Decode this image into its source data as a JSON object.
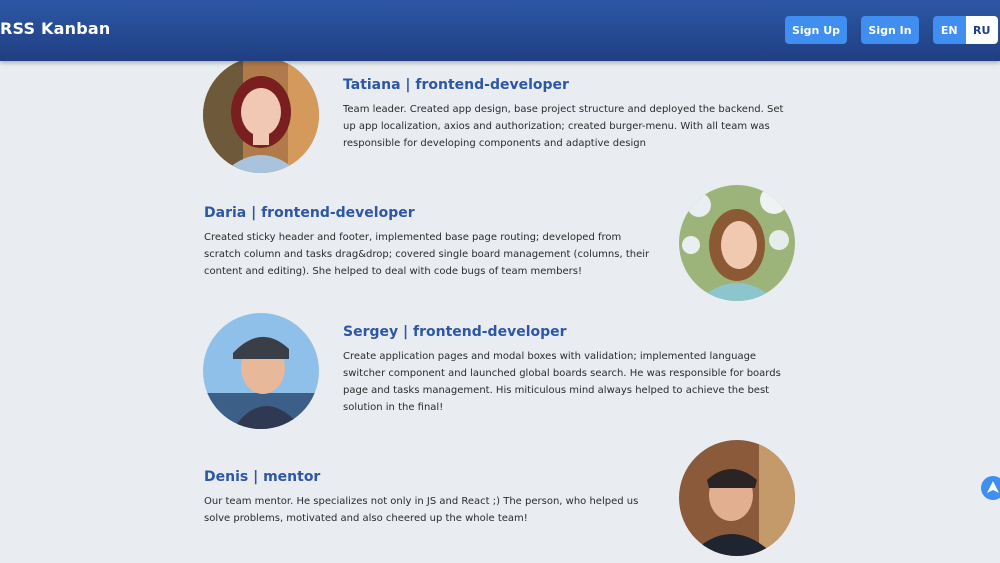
{
  "header": {
    "logo": "RSS Kanban",
    "sign_up": "Sign Up",
    "sign_in": "Sign In",
    "lang_en": "EN",
    "lang_ru": "RU"
  },
  "members": [
    {
      "name": "Tatiana | frontend-developer",
      "description": "Team leader. Created app design, base project structure and deployed the backend. Set up app localization, axios and authorization; created burger-menu. With all team was responsible for developing components and adaptive design"
    },
    {
      "name": "Daria | frontend-developer",
      "description": "Created sticky header and footer, implemented base page routing; developed from scratch column and tasks drag&drop; covered single board management (columns, their content and editing). She helped to deal with code bugs of team members!"
    },
    {
      "name": "Sergey | frontend-developer",
      "description": "Create application pages and modal boxes with validation; implemented language switcher component and launched global boards search. He was responsible for boards page and tasks management. His miticulous mind always helped to achieve the best solution in the final!"
    },
    {
      "name": "Denis | mentor",
      "description": "Our team mentor. He specializes not only in JS and React ;) The person, who helped us solve problems, motivated and also cheered up the whole team!"
    }
  ],
  "icons": {
    "scroll_top": "arrow-up-icon"
  }
}
